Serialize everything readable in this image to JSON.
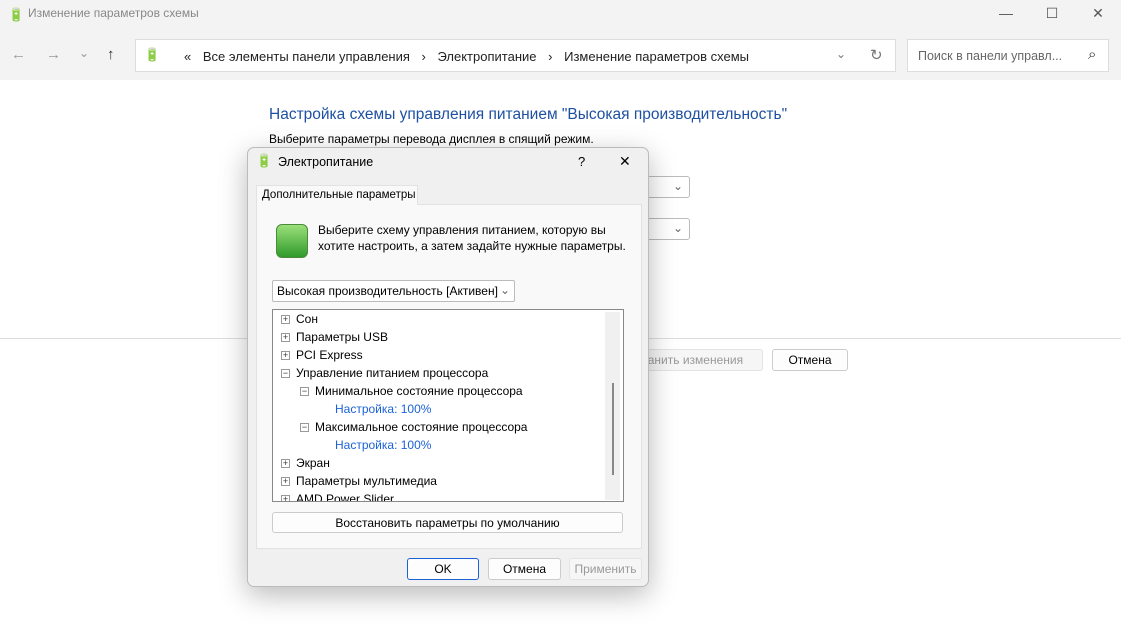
{
  "window": {
    "title": "Изменение параметров схемы",
    "minimize": "—",
    "maximize": "☐",
    "close": "✕"
  },
  "nav": {
    "back": "←",
    "forward": "→",
    "recent": "⌄",
    "up": "↑",
    "refresh": "↻",
    "dropdown": "⌄",
    "breadcrumb": [
      "«",
      "Все элементы панели управления",
      "›",
      "Электропитание",
      "›",
      "Изменение параметров схемы"
    ],
    "search_placeholder": "Поиск в панели управл...",
    "search_icon": "⌕"
  },
  "main": {
    "heading": "Настройка схемы управления питанием \"Высокая производительность\"",
    "subtitle": "Выберите параметры перевода дисплея в спящий режим.",
    "save_label": "Сохранить изменения",
    "cancel_label": "Отмена"
  },
  "dialog": {
    "title": "Электропитание",
    "help": "?",
    "close": "✕",
    "tab": "Дополнительные параметры",
    "description": "Выберите схему управления питанием, которую вы хотите настроить, а затем задайте нужные параметры.",
    "plan": "Высокая производительность [Активен]",
    "tree": [
      {
        "label": "Сон",
        "state": "+"
      },
      {
        "label": "Параметры USB",
        "state": "+"
      },
      {
        "label": "PCI Express",
        "state": "+"
      },
      {
        "label": "Управление питанием процессора",
        "state": "−"
      },
      {
        "label": "Минимальное состояние процессора",
        "state": "−"
      },
      {
        "label": "Настройка: 100%"
      },
      {
        "label": "Максимальное состояние процессора",
        "state": "−"
      },
      {
        "label": "Настройка: 100%"
      },
      {
        "label": "Экран",
        "state": "+"
      },
      {
        "label": "Параметры мультимедиа",
        "state": "+"
      },
      {
        "label": "AMD Power Slider",
        "state": "+"
      }
    ],
    "restore": "Восстановить параметры по умолчанию",
    "ok": "OK",
    "cancel": "Отмена",
    "apply": "Применить"
  }
}
